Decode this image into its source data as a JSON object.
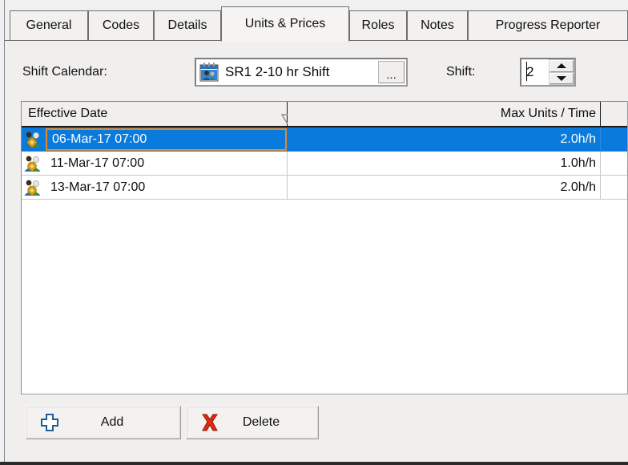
{
  "tabs": [
    {
      "label": "General",
      "active": false
    },
    {
      "label": "Codes",
      "active": false
    },
    {
      "label": "Details",
      "active": false
    },
    {
      "label": "Units & Prices",
      "active": true
    },
    {
      "label": "Roles",
      "active": false
    },
    {
      "label": "Notes",
      "active": false
    },
    {
      "label": "Progress Reporter",
      "active": false
    }
  ],
  "form": {
    "shift_calendar_label": "Shift Calendar:",
    "shift_calendar_value": "SR1 2-10 hr Shift",
    "shift_calendar_browse_label": "...",
    "shift_calendar_icon": "calendar-people-icon",
    "shift_label": "Shift:",
    "shift_value": "2",
    "spinner_up_icon": "spinner-up-icon",
    "spinner_down_icon": "spinner-down-icon"
  },
  "grid": {
    "columns": [
      {
        "key": "effective_date",
        "label": "Effective Date",
        "align": "left",
        "sort_indicator": "sort-descending-icon"
      },
      {
        "key": "max_units_time",
        "label": "Max Units / Time",
        "align": "right"
      },
      {
        "key": "extra",
        "label": "",
        "align": "left"
      }
    ],
    "rows": [
      {
        "icon": "resource-assignment-icon",
        "effective_date": "06-Mar-17 07:00",
        "max_units_time": "2.0h/h",
        "extra": "",
        "selected": true
      },
      {
        "icon": "resource-assignment-icon",
        "effective_date": "11-Mar-17 07:00",
        "max_units_time": "1.0h/h",
        "extra": "",
        "selected": false
      },
      {
        "icon": "resource-assignment-icon",
        "effective_date": "13-Mar-17 07:00",
        "max_units_time": "2.0h/h",
        "extra": "",
        "selected": false
      }
    ]
  },
  "buttons": {
    "add_label": "Add",
    "add_icon": "plus-icon",
    "delete_label": "Delete",
    "delete_icon": "red-x-icon"
  },
  "colors": {
    "selection_blue": "#0a7bdc",
    "focus_outline_orange": "#e08a2e",
    "panel_bg": "#f0efee",
    "grid_bg": "#ffffff"
  }
}
